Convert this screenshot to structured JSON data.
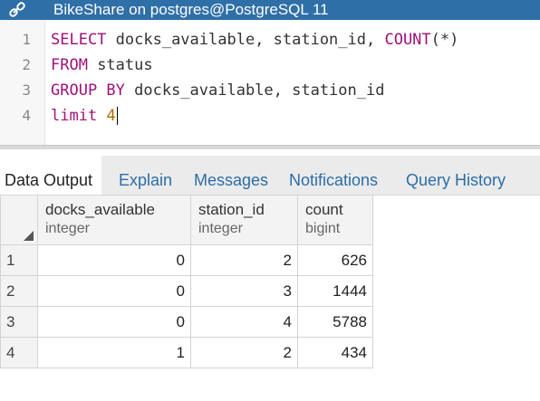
{
  "window": {
    "title": "BikeShare on postgres@PostgreSQL 11",
    "icon": "connection-link-icon"
  },
  "editor": {
    "lines": [
      {
        "num": "1",
        "tokens": [
          {
            "t": "SELECT",
            "k": "kw"
          },
          {
            "t": " docks_available, station_id, ",
            "k": ""
          },
          {
            "t": "COUNT",
            "k": "kw"
          },
          {
            "t": "(*)",
            "k": ""
          }
        ]
      },
      {
        "num": "2",
        "tokens": [
          {
            "t": "FROM",
            "k": "kw"
          },
          {
            "t": " status",
            "k": ""
          }
        ]
      },
      {
        "num": "3",
        "tokens": [
          {
            "t": "GROUP BY",
            "k": "kw"
          },
          {
            "t": " docks_available, station_id",
            "k": ""
          }
        ]
      },
      {
        "num": "4",
        "tokens": [
          {
            "t": "limit",
            "k": "kw"
          },
          {
            "t": " ",
            "k": ""
          },
          {
            "t": "4",
            "k": "num"
          }
        ]
      }
    ]
  },
  "tabs": [
    {
      "label": "Data Output",
      "active": true
    },
    {
      "label": "Explain",
      "active": false
    },
    {
      "label": "Messages",
      "active": false
    },
    {
      "label": "Notifications",
      "active": false
    },
    {
      "label": "Query History",
      "active": false
    }
  ],
  "results": {
    "columns": [
      {
        "name": "docks_available",
        "type": "integer"
      },
      {
        "name": "station_id",
        "type": "integer"
      },
      {
        "name": "count",
        "type": "bigint"
      }
    ],
    "rows": [
      {
        "num": "1",
        "cells": [
          "0",
          "2",
          "626"
        ]
      },
      {
        "num": "2",
        "cells": [
          "0",
          "3",
          "1444"
        ]
      },
      {
        "num": "3",
        "cells": [
          "0",
          "4",
          "5788"
        ]
      },
      {
        "num": "4",
        "cells": [
          "1",
          "2",
          "434"
        ]
      }
    ]
  },
  "colors": {
    "titlebar": "#2f6fa7",
    "keyword": "#a0117a",
    "number": "#a87000",
    "tab_link": "#2c6da6"
  }
}
